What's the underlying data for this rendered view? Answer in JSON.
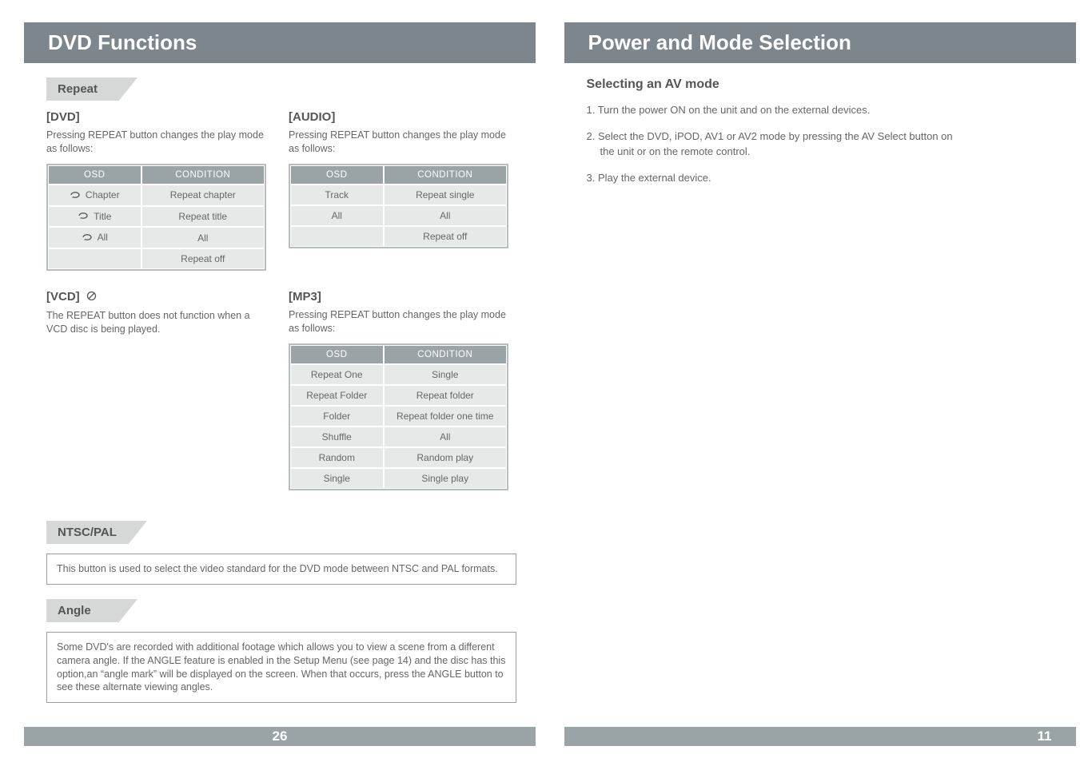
{
  "left": {
    "title": "DVD Functions",
    "repeat": {
      "tab": "Repeat",
      "dvd": {
        "heading": "[DVD]",
        "desc": "Pressing REPEAT button changes the play mode as follows:",
        "headers": [
          "OSD",
          "CONDITION"
        ],
        "rows": [
          {
            "osd": "Chapter",
            "cond": "Repeat chapter",
            "icon": true
          },
          {
            "osd": "Title",
            "cond": "Repeat title",
            "icon": true
          },
          {
            "osd": "All",
            "cond": "All",
            "icon": true
          },
          {
            "osd": "",
            "cond": "Repeat off",
            "icon": false
          }
        ]
      },
      "audio": {
        "heading": "[AUDIO]",
        "desc": "Pressing REPEAT button changes the play mode as follows:",
        "headers": [
          "OSD",
          "CONDITION"
        ],
        "rows": [
          {
            "osd": "Track",
            "cond": "Repeat single"
          },
          {
            "osd": "All",
            "cond": "All"
          },
          {
            "osd": "",
            "cond": "Repeat off"
          }
        ]
      },
      "vcd": {
        "heading": "[VCD]",
        "desc": "The REPEAT button does not function when a VCD disc is being played."
      },
      "mp3": {
        "heading": "[MP3]",
        "desc": "Pressing REPEAT button changes the play mode as follows:",
        "headers": [
          "OSD",
          "CONDITION"
        ],
        "rows": [
          {
            "osd": "Repeat One",
            "cond": "Single"
          },
          {
            "osd": "Repeat Folder",
            "cond": "Repeat folder"
          },
          {
            "osd": "Folder",
            "cond": "Repeat folder one time"
          },
          {
            "osd": "Shuffle",
            "cond": "All"
          },
          {
            "osd": "Random",
            "cond": "Random play"
          },
          {
            "osd": "Single",
            "cond": "Single play"
          }
        ]
      }
    },
    "ntsc": {
      "tab": "NTSC/PAL",
      "text": "This button is used to select the video standard for the DVD mode between NTSC and PAL formats."
    },
    "angle": {
      "tab": "Angle",
      "text": "Some DVD's are recorded with additional footage which allows you to view a scene from a different camera angle. If the ANGLE feature is enabled in the Setup Menu (see page 14) and the disc has this option,an “angle mark” will be displayed on the screen. When that occurs, press the ANGLE button to see these alternate viewing angles."
    },
    "page_number": "26"
  },
  "right": {
    "title": "Power and Mode Selection",
    "heading": "Selecting an AV mode",
    "items": {
      "i1": "1. Turn the power ON on the unit and on the external devices.",
      "i2a": "2. Select the DVD, iPOD, AV1 or AV2 mode by pressing the AV Select button on",
      "i2b": "the unit or on the remote control.",
      "i3": "3. Play the external device."
    },
    "page_number": "11"
  }
}
